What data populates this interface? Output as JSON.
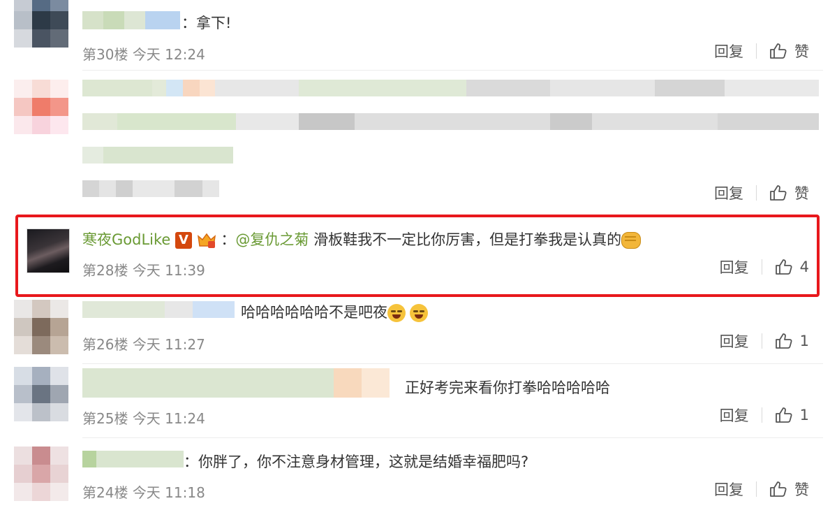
{
  "comments": [
    {
      "floor": "第30楼",
      "time": "今天 12:24",
      "text": "：拿下!",
      "reply": "回复",
      "likes": "赞"
    },
    {
      "floor": "",
      "time": "",
      "text": "",
      "reply": "回复",
      "likes": "赞"
    },
    {
      "floor": "第28楼",
      "time": "今天 11:39",
      "username": "寒夜GodLike",
      "badge": "V",
      "mention": "@复仇之菊",
      "text": "滑板鞋我不一定比你厉害，但是打拳我是认真的",
      "reply": "回复",
      "likes": "4"
    },
    {
      "floor": "第26楼",
      "time": "今天 11:27",
      "text": "哈哈哈哈哈哈不是吧夜",
      "reply": "回复",
      "likes": "1"
    },
    {
      "floor": "第25楼",
      "time": "今天 11:24",
      "text": "正好考完来看你打拳哈哈哈哈哈",
      "reply": "回复",
      "likes": "1"
    },
    {
      "floor": "第24楼",
      "time": "今天 11:18",
      "text": "：你胖了，你不注意身材管理，这就是结婚幸福肥吗?",
      "reply": "回复",
      "likes": "赞"
    }
  ],
  "colors": {
    "highlight": "#e8181c",
    "username": "#6a9a34",
    "meta": "#888888"
  }
}
